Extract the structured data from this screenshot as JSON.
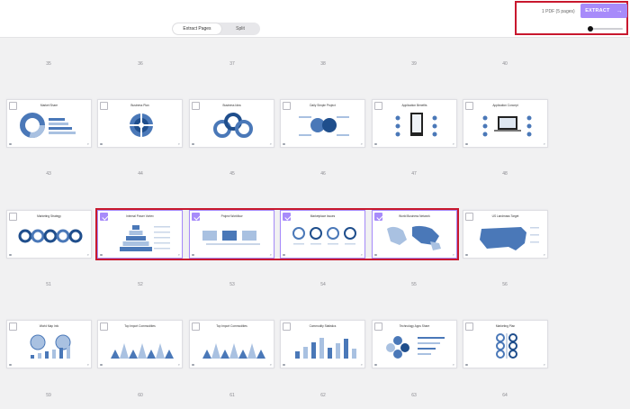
{
  "header": {
    "tabs": [
      {
        "label": "Extract Pages"
      },
      {
        "label": "Split"
      }
    ],
    "pdf_count": "1 PDF (5 pages)",
    "extract_label": "EXTRACT",
    "extract_arrow": "→"
  },
  "rows": [
    {
      "page_numbers": [
        "35",
        "36",
        "37",
        "38",
        "39",
        "40"
      ],
      "cards": [
        {
          "title": "Market Share",
          "art": "pie",
          "selected": false
        },
        {
          "title": "Business Plan",
          "art": "target",
          "selected": false
        },
        {
          "title": "Business Idea",
          "art": "circles3",
          "selected": false
        },
        {
          "title": "Daily Simple Project",
          "art": "brain",
          "selected": false
        },
        {
          "title": "Application Benefits",
          "art": "tablet",
          "selected": false
        },
        {
          "title": "Application Concept",
          "art": "laptop",
          "selected": false
        }
      ]
    },
    {
      "page_numbers": [
        "43",
        "44",
        "45",
        "46",
        "47",
        "48"
      ],
      "cards": [
        {
          "title": "Marketing Strategy",
          "art": "rings",
          "selected": false
        },
        {
          "title": "Internal Power Vortex",
          "art": "pyramid",
          "selected": true
        },
        {
          "title": "Project Workflow",
          "art": "boxes",
          "selected": true
        },
        {
          "title": "Marketplace Issues",
          "art": "gauges",
          "selected": true
        },
        {
          "title": "World Business Network",
          "art": "worldmap",
          "selected": true
        },
        {
          "title": "US Landmass Target",
          "art": "usmap",
          "selected": false
        }
      ]
    },
    {
      "page_numbers": [
        "51",
        "52",
        "53",
        "54",
        "55",
        "56"
      ],
      "cards": [
        {
          "title": "World Map Info",
          "art": "globes",
          "selected": false
        },
        {
          "title": "Top Import Commodities",
          "art": "peaks",
          "selected": false
        },
        {
          "title": "Top Import Commodities",
          "art": "peaks2",
          "selected": false
        },
        {
          "title": "Commodity Statistics",
          "art": "bars",
          "selected": false
        },
        {
          "title": "Technology Apps Share",
          "art": "hexes",
          "selected": false
        },
        {
          "title": "Marketing Plan",
          "art": "tree",
          "selected": false
        }
      ]
    },
    {
      "page_numbers": [
        "59",
        "60",
        "61",
        "62",
        "63",
        "64"
      ],
      "cards": []
    }
  ],
  "icons": {
    "checkbox": "checkbox-icon",
    "zoom": "magnifier-icon",
    "arrow": "arrow-right-icon"
  },
  "colors": {
    "accent": "#a78bfa",
    "highlight": "#c8182e",
    "slide_blue": "#4a78b8"
  }
}
